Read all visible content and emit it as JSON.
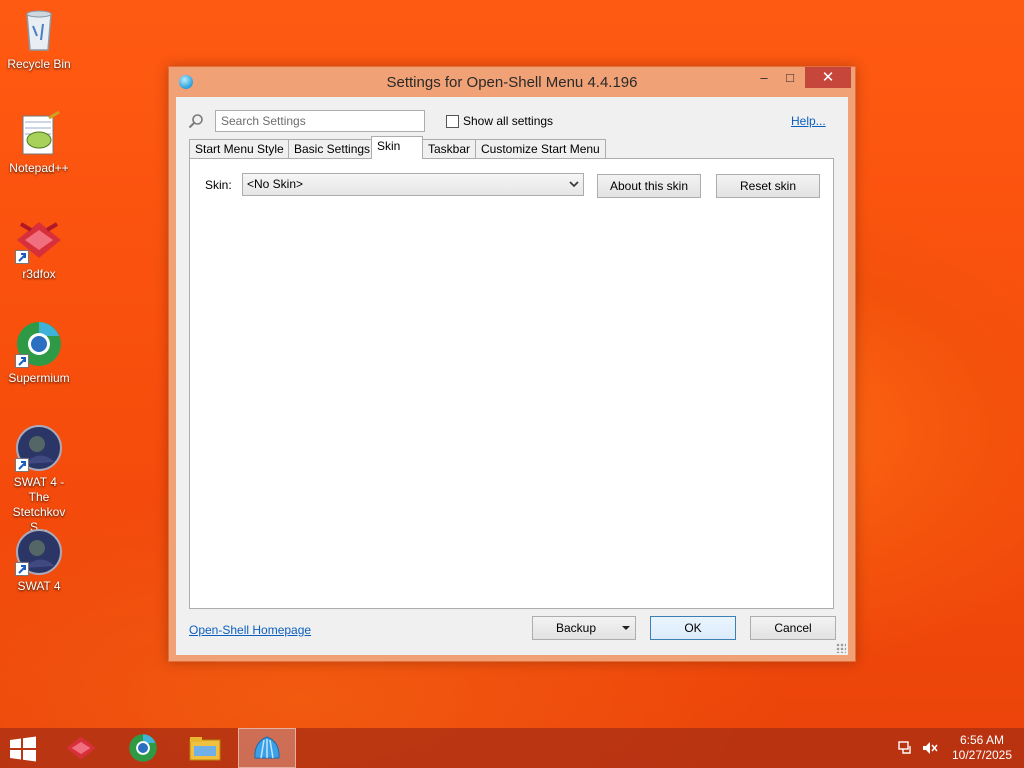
{
  "desktop": {
    "icons": [
      {
        "label": "Recycle Bin",
        "icon": "recycle-bin-icon"
      },
      {
        "label": "Notepad++",
        "icon": "notepadpp-icon"
      },
      {
        "label": "r3dfox",
        "icon": "r3dfox-icon"
      },
      {
        "label": "Supermium",
        "icon": "supermium-icon"
      },
      {
        "label": "SWAT 4 - The Stetchkov S...",
        "icon": "swat4-icon"
      },
      {
        "label": "SWAT 4",
        "icon": "swat4-icon"
      }
    ]
  },
  "window": {
    "title": "Settings for Open-Shell Menu 4.4.196",
    "controls": {
      "minimize": "–",
      "maximize": "□",
      "close": "✕"
    },
    "search": {
      "placeholder": "Search Settings",
      "value": ""
    },
    "show_all": {
      "label": "Show all settings",
      "checked": false
    },
    "help_link": "Help...",
    "tabs": [
      {
        "label": "Start Menu Style",
        "active": false
      },
      {
        "label": "Basic Settings",
        "active": false
      },
      {
        "label": "Skin",
        "active": true
      },
      {
        "label": "Taskbar",
        "active": false
      },
      {
        "label": "Customize Start Menu",
        "active": false
      }
    ],
    "skin": {
      "label": "Skin:",
      "selected": "<No Skin>",
      "about_button": "About this skin",
      "reset_button": "Reset skin"
    },
    "footer": {
      "homepage_link": "Open-Shell Homepage",
      "backup_button": "Backup",
      "ok_button": "OK",
      "cancel_button": "Cancel"
    }
  },
  "taskbar": {
    "items": [
      {
        "name": "r3dfox",
        "icon": "r3dfox-icon",
        "active": false
      },
      {
        "name": "Supermium",
        "icon": "supermium-icon",
        "active": false
      },
      {
        "name": "File Explorer",
        "icon": "file-explorer-icon",
        "active": false
      },
      {
        "name": "Open-Shell Settings",
        "icon": "open-shell-icon",
        "active": true
      }
    ],
    "clock": {
      "time": "6:56 AM",
      "date": "10/27/2025"
    }
  },
  "colors": {
    "accent_link": "#0b5fc0",
    "close_button": "#c7463b",
    "window_frame": "#f0a176",
    "desktop": "#f74d0c"
  }
}
